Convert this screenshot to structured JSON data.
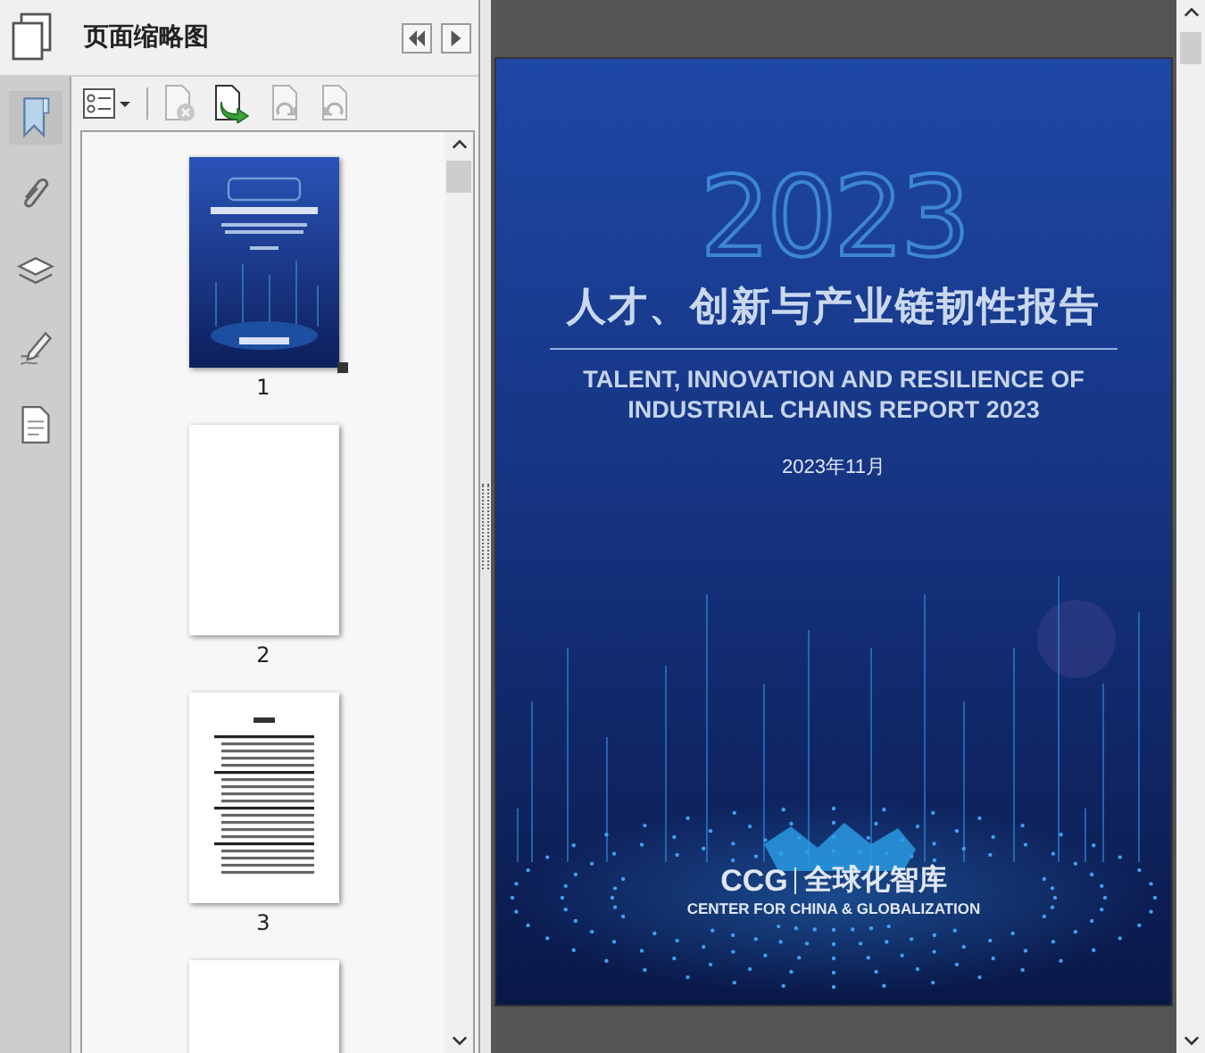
{
  "panel": {
    "title": "页面缩略图"
  },
  "nav_buttons": [
    {
      "kind": "collapse"
    },
    {
      "kind": "expand"
    }
  ],
  "rail_items": [
    {
      "kind": "bookmark",
      "selected": true
    },
    {
      "kind": "attachment",
      "selected": false
    },
    {
      "kind": "layers",
      "selected": false
    },
    {
      "kind": "signature",
      "selected": false
    },
    {
      "kind": "document",
      "selected": false
    }
  ],
  "toolbar": [
    {
      "kind": "options",
      "disabled": false
    },
    {
      "kind": "delete",
      "disabled": true
    },
    {
      "kind": "insert",
      "disabled": false
    },
    {
      "kind": "redo",
      "disabled": true
    },
    {
      "kind": "undo",
      "disabled": true
    }
  ],
  "thumbnails": [
    {
      "kind": "cover",
      "label": "1",
      "selected": true
    },
    {
      "kind": "blank",
      "label": "2",
      "selected": false
    },
    {
      "kind": "contents",
      "label": "3",
      "selected": false
    },
    {
      "kind": "blank",
      "selected": false
    }
  ],
  "cover": {
    "year": "2023",
    "title": "人才、创新与产业链韧性报告",
    "subtitle_lines": [
      "TALENT, INNOVATION AND RESILIENCE OF",
      "INDUSTRIAL CHAINS REPORT 2023"
    ],
    "date": "2023年11月",
    "logo_mark": "CCG",
    "logo_name": "全球化智库",
    "logo_tagline": "CENTER FOR CHINA & GLOBALIZATION"
  }
}
